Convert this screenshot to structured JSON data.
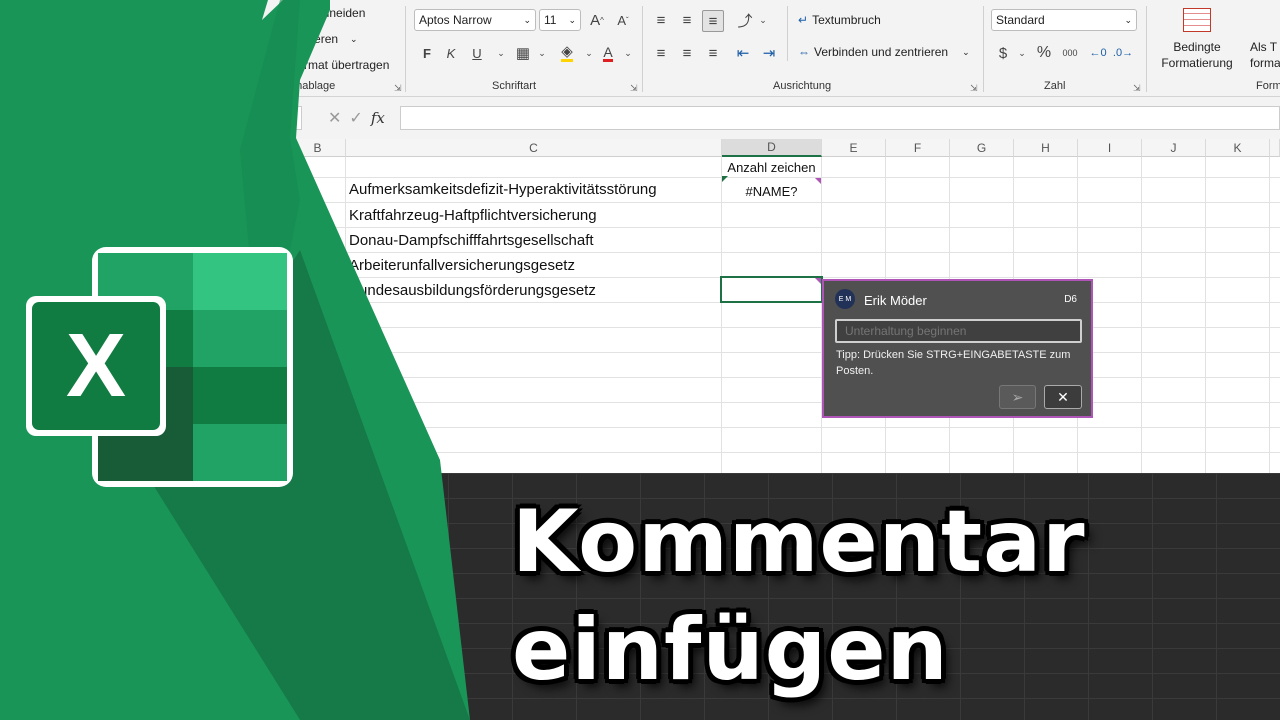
{
  "ribbon": {
    "clipboard": {
      "cut": "Ausschneiden",
      "copy": "Kopieren",
      "format_painter": "Format übertragen",
      "group": "enablage"
    },
    "font": {
      "name": "Aptos Narrow",
      "size": "11",
      "bold": "F",
      "italic": "K",
      "underline": "U",
      "group": "Schriftart"
    },
    "alignment": {
      "wrap": "Textumbruch",
      "merge": "Verbinden und zentrieren",
      "group": "Ausrichtung"
    },
    "number": {
      "format": "Standard",
      "currency": "$",
      "percent": "%",
      "thousands": "000",
      "group": "Zahl"
    },
    "styles": {
      "conditional": "Bedingte Formatierung",
      "table": "Als T formati",
      "group": "Form"
    }
  },
  "formula_bar": {
    "fx": "fx",
    "value": ""
  },
  "grid": {
    "columns": [
      "B",
      "C",
      "D",
      "E",
      "F",
      "G",
      "H",
      "I",
      "J",
      "K"
    ],
    "header_d1": "Anzahl zeichen",
    "error_d2": "#NAME?",
    "words": [
      "Aufmerksamkeitsdefizit-Hyperaktivitätsstörung",
      "Kraftfahrzeug-Haftpflichtversicherung",
      "Donau-Dampfschifffahrtsgesellschaft",
      "Arbeiterunfallversicherungsgesetz",
      "Bundesausbildungsförderungsgesetz"
    ]
  },
  "comment": {
    "author": "Erik Möder",
    "cell_ref": "D6",
    "placeholder": "Unterhaltung beginnen",
    "tip": "Tipp: Drücken Sie STRG+EINGABETASTE zum Posten.",
    "send_icon": "send-icon",
    "close_icon": "close-icon"
  },
  "overlay": {
    "line1": "Kommentar",
    "line2": "einfügen",
    "logo_letter": "X"
  },
  "colors": {
    "excel_green": "#1a9558",
    "accent": "#b055b8",
    "dark": "#2b2b2b"
  }
}
